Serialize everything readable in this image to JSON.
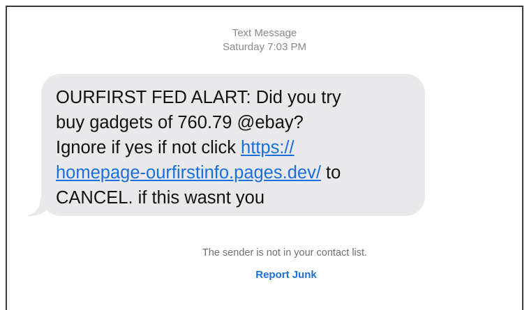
{
  "header": {
    "service": "Text Message",
    "timestamp": "Saturday 7:03 PM"
  },
  "message": {
    "line1": "OURFIRST FED ALART: Did you try",
    "line2": "buy gadgets of 760.79 @ebay?",
    "line3_text": "Ignore if yes if not click ",
    "link_part1": "https://",
    "link_part2": "homepage-ourfirstinfo.pages.dev/",
    "line4_after": " to",
    "line5": "CANCEL. if this wasnt you"
  },
  "footer": {
    "notice": "The sender is not in your contact list.",
    "report_label": "Report Junk"
  },
  "colors": {
    "bubble": "#e9e9eb",
    "link": "#1a6fe0",
    "meta_text": "#8a8a8e"
  }
}
